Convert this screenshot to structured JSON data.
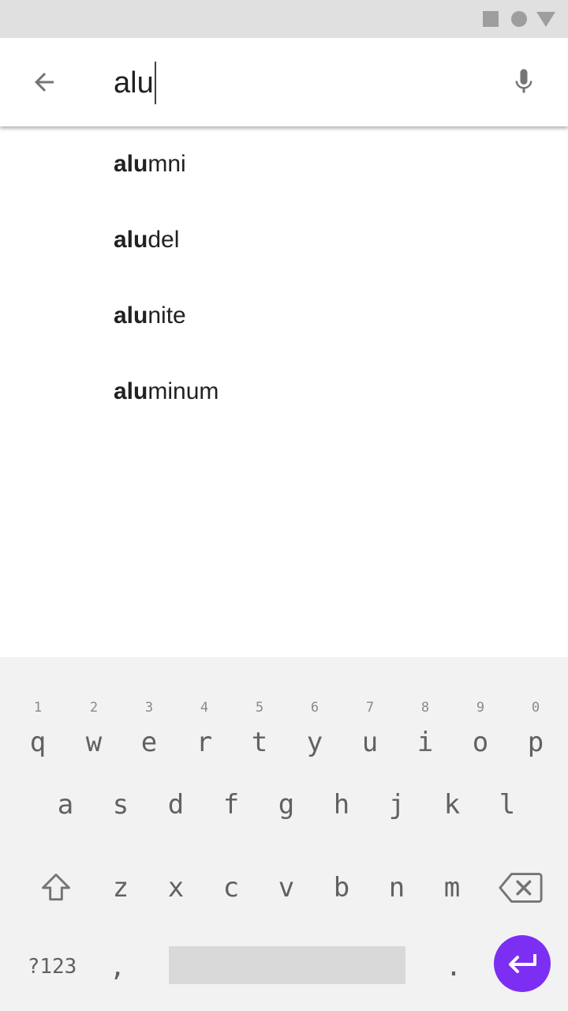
{
  "search": {
    "query": "alu"
  },
  "suggestions": [
    {
      "prefix": "alu",
      "rest": "mni"
    },
    {
      "prefix": "alu",
      "rest": "del"
    },
    {
      "prefix": "alu",
      "rest": "nite"
    },
    {
      "prefix": "alu",
      "rest": "minum"
    }
  ],
  "keyboard": {
    "row1": [
      {
        "hint": "1",
        "key": "q"
      },
      {
        "hint": "2",
        "key": "w"
      },
      {
        "hint": "3",
        "key": "e"
      },
      {
        "hint": "4",
        "key": "r"
      },
      {
        "hint": "5",
        "key": "t"
      },
      {
        "hint": "6",
        "key": "y"
      },
      {
        "hint": "7",
        "key": "u"
      },
      {
        "hint": "8",
        "key": "i"
      },
      {
        "hint": "9",
        "key": "o"
      },
      {
        "hint": "0",
        "key": "p"
      }
    ],
    "row2": [
      "a",
      "s",
      "d",
      "f",
      "g",
      "h",
      "j",
      "k",
      "l"
    ],
    "row3": [
      "z",
      "x",
      "c",
      "v",
      "b",
      "n",
      "m"
    ],
    "symbols_label": "?123",
    "comma": ",",
    "period": "."
  },
  "colors": {
    "status_bar": "#e0e0e0",
    "keyboard_bg": "#f2f2f2",
    "enter_accent": "#7c2ff2",
    "icon_gray": "#757575"
  },
  "icons": {
    "back": "arrow-back-icon",
    "mic": "mic-icon",
    "shift": "shift-arrow-icon",
    "backspace": "backspace-icon",
    "enter": "enter-return-icon"
  }
}
